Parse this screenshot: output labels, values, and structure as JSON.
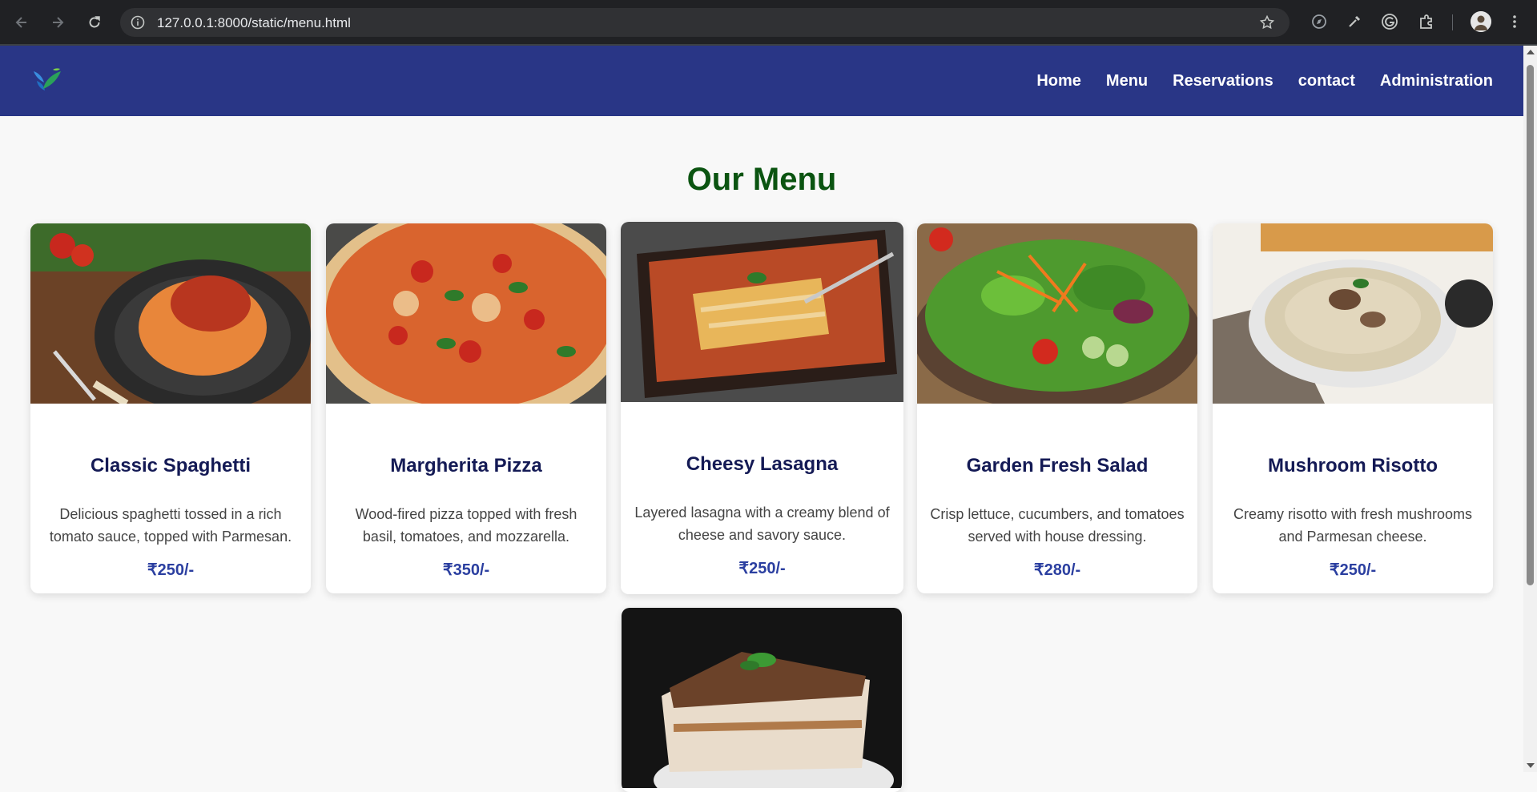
{
  "browser": {
    "url": "127.0.0.1:8000/static/menu.html",
    "icons": [
      "back-arrow-icon",
      "forward-arrow-icon",
      "reload-icon",
      "site-info-icon",
      "bookmark-star-icon",
      "compass-extension-icon",
      "eyedropper-extension-icon",
      "grammarly-extension-icon",
      "extensions-puzzle-icon",
      "profile-avatar",
      "kebab-menu-icon"
    ]
  },
  "header": {
    "logo": "bird-logo-icon",
    "nav": [
      "Home",
      "Menu",
      "Reservations",
      "contact",
      "Administration"
    ],
    "color": "#293686"
  },
  "main": {
    "title": "Our Menu",
    "title_color": "#0b5411",
    "items": [
      {
        "name": "Classic Spaghetti",
        "description": "Delicious spaghetti tossed in a rich tomato sauce, topped with Parmesan.",
        "price": "₹250/-",
        "image": "spaghetti-photo"
      },
      {
        "name": "Margherita Pizza",
        "description": "Wood-fired pizza topped with fresh basil, tomatoes, and mozzarella.",
        "price": "₹350/-",
        "image": "pizza-photo"
      },
      {
        "name": "Cheesy Lasagna",
        "description": "Layered lasagna with a creamy blend of cheese and savory sauce.",
        "price": "₹250/-",
        "image": "lasagna-photo"
      },
      {
        "name": "Garden Fresh Salad",
        "description": "Crisp lettuce, cucumbers, and tomatoes served with house dressing.",
        "price": "₹280/-",
        "image": "salad-photo"
      },
      {
        "name": "Mushroom Risotto",
        "description": "Creamy risotto with fresh mushrooms and Parmesan cheese.",
        "price": "₹250/-",
        "image": "risotto-photo"
      },
      {
        "image": "tiramisu-photo"
      }
    ]
  }
}
